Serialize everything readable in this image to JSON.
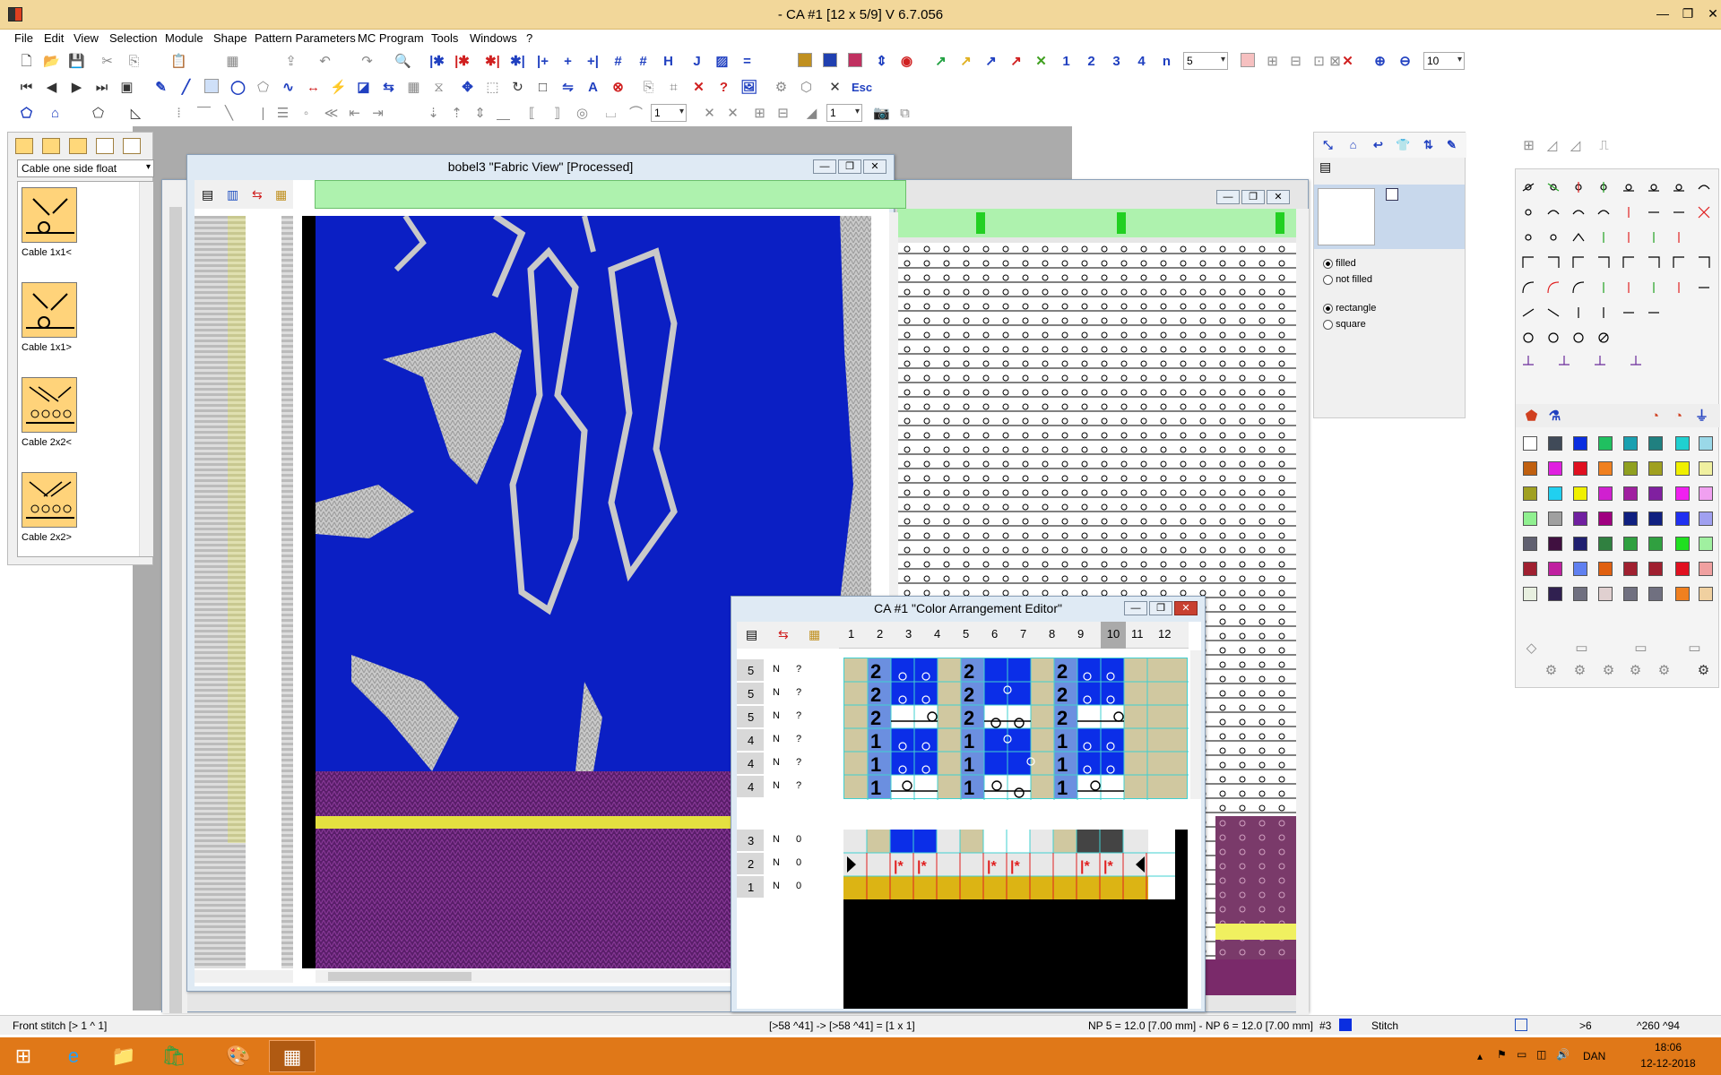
{
  "app": {
    "title": "- CA #1 [12 x 5/9]    V 6.7.056"
  },
  "menu": [
    "File",
    "Edit",
    "View",
    "Selection",
    "Module",
    "Shape",
    "Pattern Parameters",
    "MC Program",
    "Tools",
    "Windows",
    "?"
  ],
  "toolbar": {
    "num_buttons": [
      "1",
      "2",
      "3",
      "4",
      "n"
    ],
    "stitch_count": "5",
    "zoom": "10",
    "esc_label": "Esc",
    "small_combo_1": "1",
    "small_combo_2": "1"
  },
  "cable_panel": {
    "selected": "Cable one side float",
    "items": [
      "Cable 1x1<",
      "Cable 1x1>",
      "Cable 2x2<",
      "Cable 2x2>"
    ]
  },
  "fabric_view": {
    "title": "bobel3 \"Fabric View\" [Processed]"
  },
  "color_arrangement": {
    "title": "CA #1 \"Color Arrangement Editor\"",
    "columns": [
      "1",
      "2",
      "3",
      "4",
      "5",
      "6",
      "7",
      "8",
      "9",
      "10",
      "11",
      "12"
    ],
    "upper_rows": [
      {
        "num": "5",
        "n": "N",
        "q": "?"
      },
      {
        "num": "5",
        "n": "N",
        "q": "?"
      },
      {
        "num": "5",
        "n": "N",
        "q": "?"
      },
      {
        "num": "4",
        "n": "N",
        "q": "?"
      },
      {
        "num": "4",
        "n": "N",
        "q": "?"
      },
      {
        "num": "4",
        "n": "N",
        "q": "?"
      }
    ],
    "lower_rows": [
      {
        "num": "3",
        "n": "N",
        "q": "0"
      },
      {
        "num": "2",
        "n": "N",
        "q": "0"
      },
      {
        "num": "1",
        "n": "N",
        "q": "0"
      }
    ],
    "system_digits": [
      "2",
      "2",
      "2",
      "1",
      "1",
      "1"
    ]
  },
  "right_panel": {
    "fill_options": [
      "filled",
      "not filled"
    ],
    "shape_options": [
      "rectangle",
      "square"
    ]
  },
  "statusbar": {
    "left": "Front stitch [> 1 ^ 1]",
    "mid": "[>58 ^41] -> [>58 ^41] = [1 x 1]",
    "np": "NP 5 = 12.0 [7.00 mm] - NP 6 = 12.0 [7.00 mm]",
    "color_no": "#3",
    "mode": "Stitch",
    "pos1": ">6",
    "pos2": "^260  ^94"
  },
  "taskbar": {
    "lang": "DAN",
    "time": "18:06",
    "date": "12-12-2018"
  },
  "colors": {
    "knit_blue": "#0b1fc4",
    "knit_grey": "#c8c8c8",
    "taskbar": "#e07818",
    "titlebar": "#f2d79a"
  }
}
